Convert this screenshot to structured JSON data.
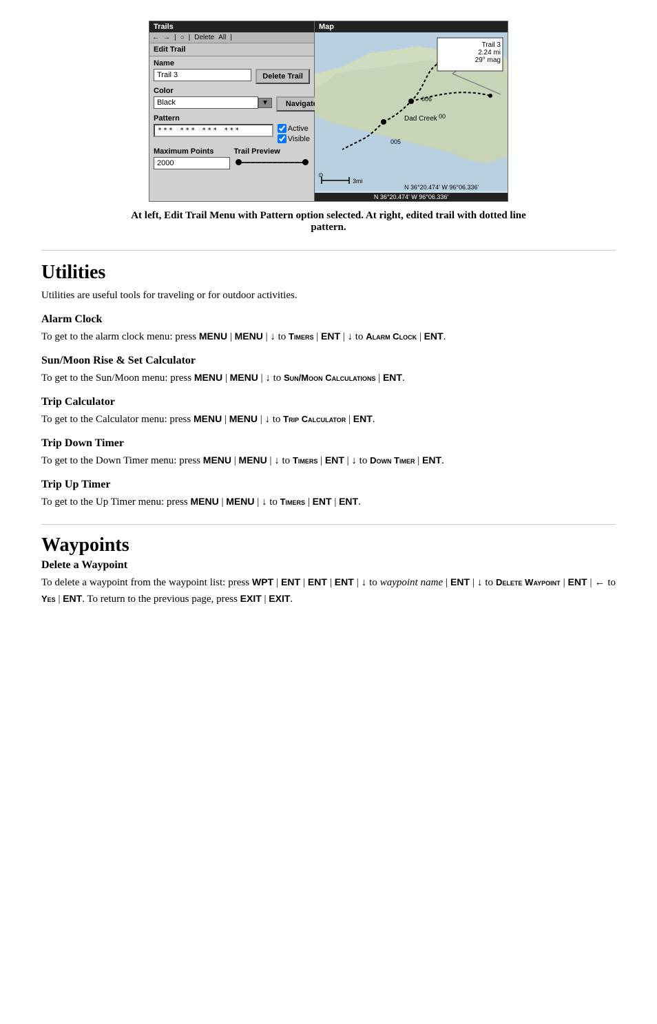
{
  "screenshot": {
    "left_panel": {
      "title": "Trails",
      "edit_title": "Edit Trail",
      "toolbar_items": [
        "←",
        "→",
        "||",
        "○",
        "||",
        "Delete",
        "All",
        "||"
      ],
      "name_label": "Name",
      "name_value": "Trail 3",
      "delete_btn": "Delete Trail",
      "color_label": "Color",
      "color_value": "Black",
      "navigate_btn": "Navigate",
      "pattern_label": "Pattern",
      "pattern_value": "*** *** *** ***",
      "active_label": "Active",
      "visible_label": "Visible",
      "max_points_label": "Maximum Points",
      "max_points_value": "2000",
      "trail_preview_label": "Trail Preview"
    },
    "map_panel": {
      "title": "Map",
      "trail_info": "Trail 3\n2.24 mi\n29° mag",
      "scale": "3mi",
      "coords": "N  36°20.474'  W  96°06.336'",
      "labels": [
        "Dad Creek",
        "006",
        "005",
        "00"
      ]
    }
  },
  "caption": "At left, Edit Trail Menu with Pattern option selected. At right, edited trail with dotted line pattern.",
  "sections": [
    {
      "id": "utilities",
      "title": "Utilities",
      "intro": "Utilities are useful tools for traveling or for outdoor activities.",
      "subsections": [
        {
          "id": "alarm-clock",
          "title": "Alarm Clock",
          "text_parts": [
            {
              "type": "text",
              "content": "To get to the alarm clock menu: press "
            },
            {
              "type": "bold",
              "content": "MENU"
            },
            {
              "type": "text",
              "content": " | "
            },
            {
              "type": "bold",
              "content": "MENU"
            },
            {
              "type": "text",
              "content": " | ↓ to "
            },
            {
              "type": "smallcaps",
              "content": "Timers"
            },
            {
              "type": "text",
              "content": " | "
            },
            {
              "type": "bold",
              "content": "ENT"
            },
            {
              "type": "text",
              "content": " | ↓ to "
            },
            {
              "type": "smallcaps",
              "content": "Alarm Clock"
            },
            {
              "type": "text",
              "content": " | "
            },
            {
              "type": "bold",
              "content": "ENT"
            },
            {
              "type": "text",
              "content": "."
            }
          ]
        },
        {
          "id": "sun-moon",
          "title": "Sun/Moon Rise & Set Calculator",
          "text_parts": [
            {
              "type": "text",
              "content": "To get to the Sun/Moon menu: press "
            },
            {
              "type": "bold",
              "content": "MENU"
            },
            {
              "type": "text",
              "content": " | "
            },
            {
              "type": "bold",
              "content": "MENU"
            },
            {
              "type": "text",
              "content": " | ↓ to "
            },
            {
              "type": "smallcaps",
              "content": "Sun/Moon Calculations"
            },
            {
              "type": "text",
              "content": " | "
            },
            {
              "type": "bold",
              "content": "ENT"
            },
            {
              "type": "text",
              "content": "."
            }
          ]
        },
        {
          "id": "trip-calculator",
          "title": "Trip Calculator",
          "text_parts": [
            {
              "type": "text",
              "content": "To get to the Calculator menu: press "
            },
            {
              "type": "bold",
              "content": "MENU"
            },
            {
              "type": "text",
              "content": " | "
            },
            {
              "type": "bold",
              "content": "MENU"
            },
            {
              "type": "text",
              "content": " | ↓ to "
            },
            {
              "type": "smallcaps",
              "content": "Trip Calculator"
            },
            {
              "type": "text",
              "content": " | "
            },
            {
              "type": "bold",
              "content": "ENT"
            },
            {
              "type": "text",
              "content": "."
            }
          ]
        },
        {
          "id": "trip-down-timer",
          "title": "Trip Down Timer",
          "text_parts": [
            {
              "type": "text",
              "content": "To get to the Down Timer menu: press "
            },
            {
              "type": "bold",
              "content": "MENU"
            },
            {
              "type": "text",
              "content": " | "
            },
            {
              "type": "bold",
              "content": "MENU"
            },
            {
              "type": "text",
              "content": " | ↓ to "
            },
            {
              "type": "smallcaps",
              "content": "Timers"
            },
            {
              "type": "text",
              "content": " | "
            },
            {
              "type": "bold",
              "content": "ENT"
            },
            {
              "type": "text",
              "content": " | ↓ to "
            },
            {
              "type": "smallcaps",
              "content": "Down Timer"
            },
            {
              "type": "text",
              "content": " | "
            },
            {
              "type": "bold",
              "content": "ENT"
            },
            {
              "type": "text",
              "content": "."
            }
          ]
        },
        {
          "id": "trip-up-timer",
          "title": "Trip Up Timer",
          "text_parts": [
            {
              "type": "text",
              "content": "To get to the Up Timer menu: press "
            },
            {
              "type": "bold",
              "content": "MENU"
            },
            {
              "type": "text",
              "content": " | "
            },
            {
              "type": "bold",
              "content": "MENU"
            },
            {
              "type": "text",
              "content": " | ↓ to "
            },
            {
              "type": "smallcaps",
              "content": "Timers"
            },
            {
              "type": "text",
              "content": " | "
            },
            {
              "type": "bold",
              "content": "ENT"
            },
            {
              "type": "text",
              "content": " | "
            },
            {
              "type": "bold",
              "content": "ENT"
            },
            {
              "type": "text",
              "content": "."
            }
          ]
        }
      ]
    },
    {
      "id": "waypoints",
      "title": "Waypoints",
      "subsections": [
        {
          "id": "delete-waypoint",
          "title": "Delete a Waypoint",
          "text_parts": [
            {
              "type": "text",
              "content": "To delete a waypoint from the waypoint list: press "
            },
            {
              "type": "bold",
              "content": "WPT"
            },
            {
              "type": "text",
              "content": " | "
            },
            {
              "type": "bold",
              "content": "ENT"
            },
            {
              "type": "text",
              "content": " | "
            },
            {
              "type": "bold",
              "content": "ENT"
            },
            {
              "type": "text",
              "content": " | "
            },
            {
              "type": "bold",
              "content": "ENT"
            },
            {
              "type": "text",
              "content": " | ↓ to "
            },
            {
              "type": "italic",
              "content": "waypoint name"
            },
            {
              "type": "text",
              "content": " | "
            },
            {
              "type": "bold",
              "content": "ENT"
            },
            {
              "type": "text",
              "content": " | ↓ to "
            },
            {
              "type": "smallcaps",
              "content": "Delete Waypoint"
            },
            {
              "type": "text",
              "content": " | "
            },
            {
              "type": "bold",
              "content": "ENT"
            },
            {
              "type": "text",
              "content": " | ← to "
            },
            {
              "type": "smallcaps",
              "content": "Yes"
            },
            {
              "type": "text",
              "content": " | "
            },
            {
              "type": "bold",
              "content": "ENT"
            },
            {
              "type": "text",
              "content": ". To return to the previous page, press "
            },
            {
              "type": "bold",
              "content": "EXIT"
            },
            {
              "type": "text",
              "content": " | "
            },
            {
              "type": "bold",
              "content": "EXIT"
            },
            {
              "type": "text",
              "content": "."
            }
          ]
        }
      ]
    }
  ]
}
